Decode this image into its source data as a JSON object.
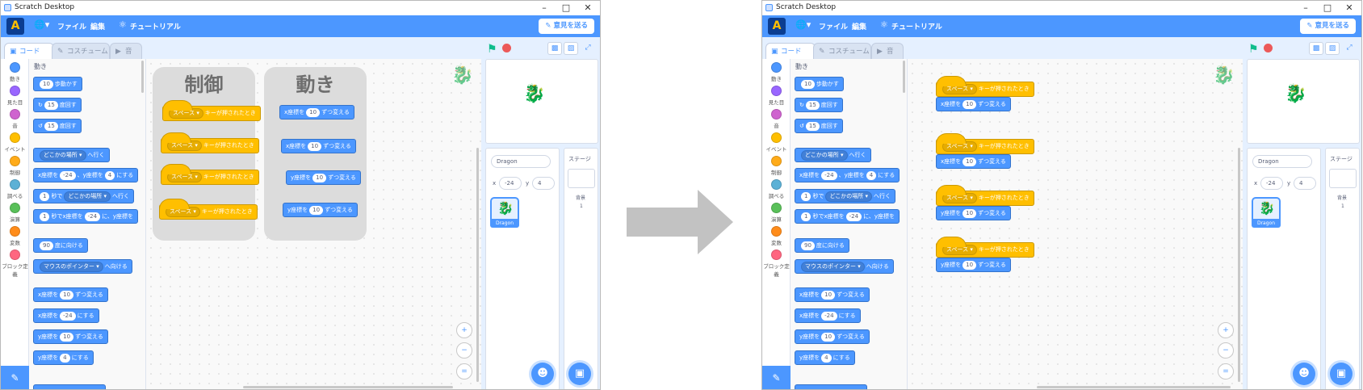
{
  "window": {
    "title": "Scratch Desktop"
  },
  "menu": {
    "logo": "A",
    "file": "ファイル",
    "edit": "編集",
    "tutorial": "チュートリアル",
    "feedback": "意見を送る"
  },
  "tabs": {
    "code": "コード",
    "costume": "コスチューム",
    "sound": "音"
  },
  "categories": [
    "動き",
    "見た目",
    "音",
    "イベント",
    "制御",
    "調べる",
    "演算",
    "変数",
    "ブロック定義"
  ],
  "category_colors": [
    "#4c97ff",
    "#9966ff",
    "#cf63cf",
    "#ffbf00",
    "#ffab19",
    "#5cb1d6",
    "#59c059",
    "#ff8c1a",
    "#ff6680"
  ],
  "palette": {
    "heading": "動き",
    "move": {
      "num": "10",
      "text": "歩動かす"
    },
    "turn_right": {
      "num": "15",
      "text": "度回す"
    },
    "turn_left": {
      "num": "15",
      "text": "度回す"
    },
    "goto": {
      "drop": "どこかの場所",
      "text": "へ行く"
    },
    "gotoxy": {
      "a": "x座標を",
      "x": "-24",
      "b": "、y座標を",
      "y": "4",
      "c": "にする"
    },
    "glide": {
      "num": "1",
      "a": "秒で",
      "drop": "どこかの場所",
      "b": "へ行く"
    },
    "glidexy": {
      "num": "1",
      "a": "秒でx座標を",
      "x": "-24",
      "b": "に、y座標を"
    },
    "point": {
      "num": "90",
      "text": "度に向ける"
    },
    "pointto": {
      "drop": "マウスのポインター",
      "text": "へ向ける"
    },
    "changex": {
      "a": "x座標を",
      "num": "10",
      "b": "ずつ変える"
    },
    "setx": {
      "a": "x座標を",
      "num": "-24",
      "b": "にする"
    },
    "changey": {
      "a": "y座標を",
      "num": "10",
      "b": "ずつ変える"
    },
    "sety": {
      "a": "y座標を",
      "num": "4",
      "b": "にする"
    }
  },
  "hat": {
    "drop": "スペース",
    "text": "キーが押されたとき"
  },
  "change_x": {
    "a": "x座標を",
    "num": "10",
    "b": "ずつ変える"
  },
  "change_y": {
    "a": "y座標を",
    "num": "10",
    "b": "ずつ変える"
  },
  "panels": {
    "control": "制御",
    "motion": "動き"
  },
  "sprite": {
    "name": "Dragon",
    "x_label": "x",
    "x": "-24",
    "y_label": "y",
    "y": "4",
    "thumb_name": "Dragon"
  },
  "stagepane": {
    "title": "ステージ",
    "backdrop_label": "背景",
    "backdrop_count": "1"
  },
  "zoom": {
    "in": "+",
    "out": "−",
    "reset": "="
  }
}
